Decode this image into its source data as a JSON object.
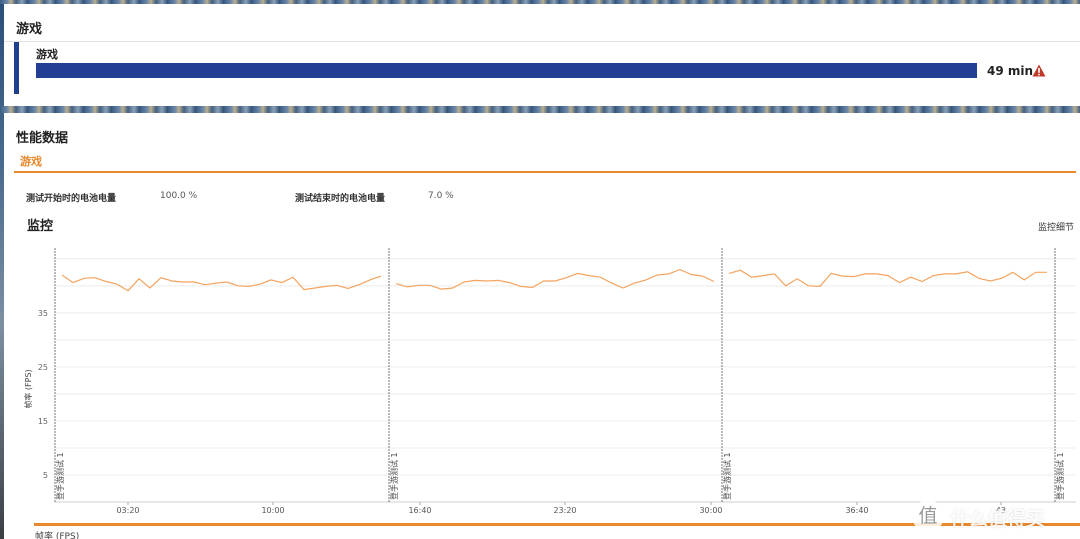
{
  "game_panel": {
    "title": "游戏",
    "item_label": "游戏",
    "duration": "49 min",
    "progress": 1.0,
    "warning_icon": "warning-triangle-icon",
    "bar_color": "#223f94",
    "warning_color": "#c0392b"
  },
  "performance": {
    "title": "性能数据",
    "tab": "游戏",
    "accent_color": "#e8892d",
    "battery_start_label": "测试开始时的电池电量",
    "battery_start_value": "100.0 %",
    "battery_end_label": "测试结束时的电池电量",
    "battery_end_value": "7.0 %",
    "monitor_title": "监控",
    "monitor_detail": "监控细节",
    "bottom_legend": "帧率 (FPS)"
  },
  "watermark": {
    "logo": "值",
    "text": "什么值得买"
  },
  "chart_data": {
    "type": "line",
    "ylabel": "帧率 (FPS)",
    "yticks": [
      5,
      15,
      25,
      35
    ],
    "ylim": [
      0,
      47
    ],
    "grid": true,
    "segment_label": "登手游测试 1",
    "series_color": "#f4a460",
    "x_tick_labels": [
      "03:20",
      "10:00",
      "16:40",
      "23:20",
      "30:00",
      "36:40",
      "43"
    ],
    "segments": [
      {
        "values": [
          42.0,
          40.6,
          41.4,
          41.5,
          40.8,
          40.3,
          39.1,
          41.3,
          39.6,
          41.5,
          40.9,
          40.7,
          40.7,
          40.2,
          40.5,
          40.7,
          40.0,
          39.9,
          40.3,
          41.1,
          40.6,
          41.6,
          39.3,
          39.6,
          39.9,
          40.1,
          39.5,
          40.2,
          41.1,
          41.8
        ]
      },
      {
        "values": [
          40.4,
          39.8,
          40.1,
          40.1,
          39.4,
          39.6,
          40.7,
          41.0,
          40.9,
          41.0,
          40.6,
          39.9,
          39.7,
          40.9,
          40.9,
          41.5,
          42.3,
          41.9,
          41.6,
          40.5,
          39.6,
          40.5,
          41.1,
          42.0,
          42.2,
          43.0,
          42.1,
          41.8,
          40.8
        ]
      },
      {
        "values": [
          42.3,
          42.9,
          41.6,
          41.9,
          42.2,
          40.0,
          41.3,
          40.0,
          39.9,
          42.3,
          41.8,
          41.7,
          42.2,
          42.2,
          41.9,
          40.6,
          41.6,
          40.8,
          41.9,
          42.2,
          42.2,
          42.6,
          41.4,
          40.9,
          41.4,
          42.5,
          41.1,
          42.5,
          42.5
        ]
      }
    ]
  }
}
